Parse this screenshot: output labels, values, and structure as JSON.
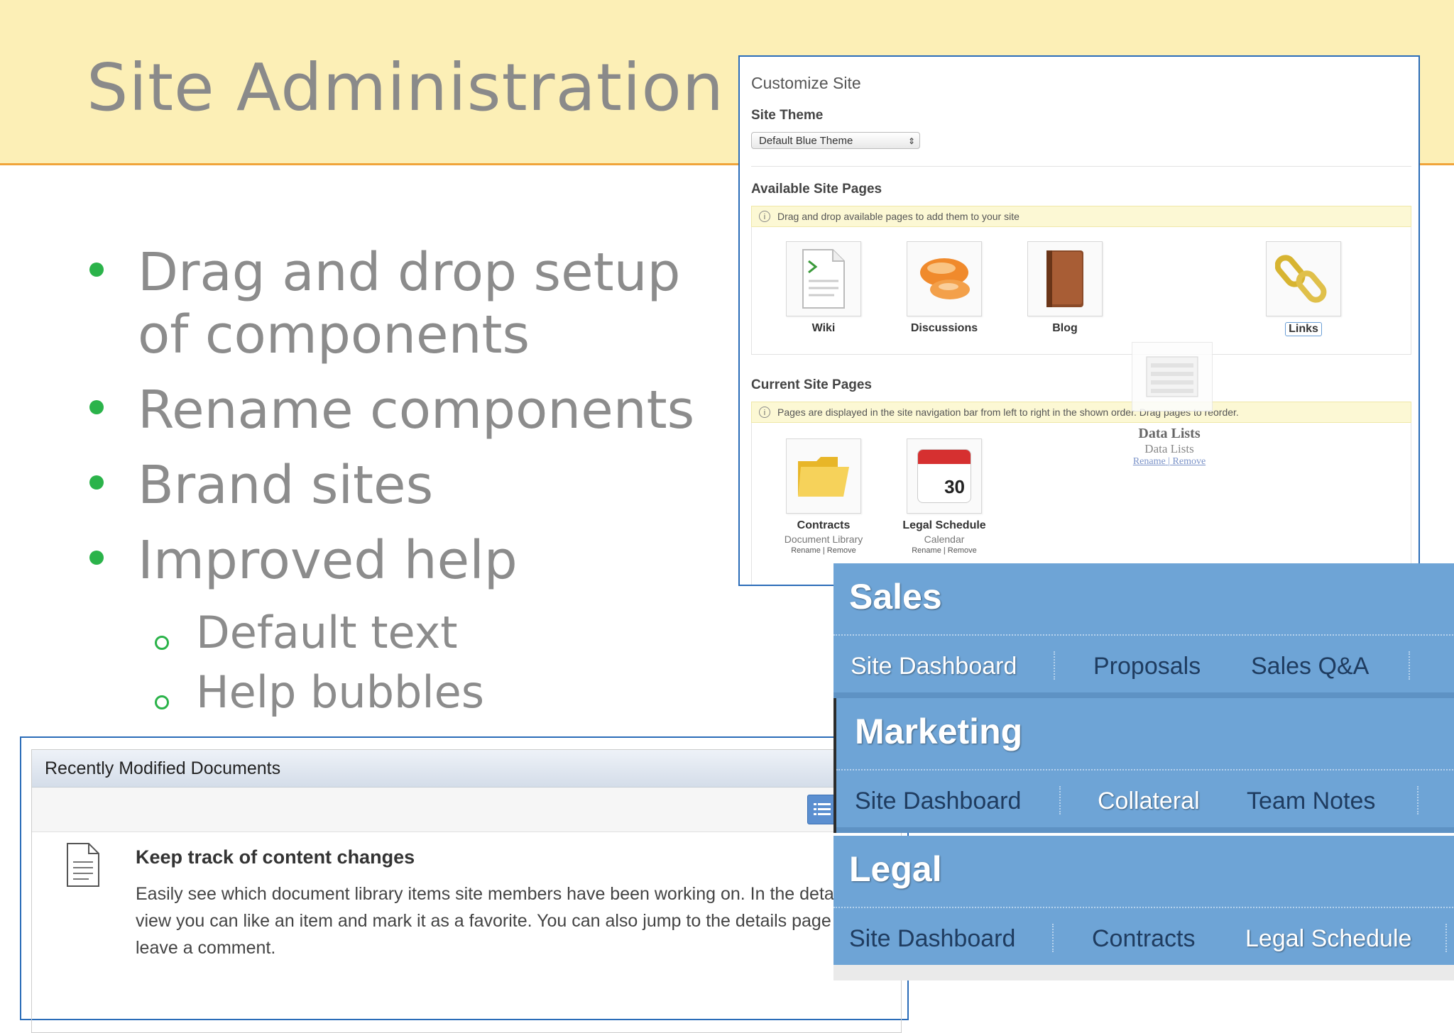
{
  "slide": {
    "title": "Site Administration",
    "bullets": [
      "Drag and drop setup of components",
      "Rename components",
      "Brand sites",
      "Improved help"
    ],
    "sub_bullets": [
      "Default text",
      "Help bubbles"
    ]
  },
  "customize_site": {
    "heading": "Customize Site",
    "theme_label": "Site Theme",
    "theme_value": "Default Blue Theme",
    "available_heading": "Available Site Pages",
    "available_info": "Drag and drop available pages to add them to your site",
    "available_pages": [
      {
        "label": "Wiki"
      },
      {
        "label": "Discussions"
      },
      {
        "label": "Blog"
      },
      {
        "label": "Links"
      }
    ],
    "current_heading": "Current Site Pages",
    "current_info": "Pages are displayed in the site navigation bar from left to right in the shown order. Drag pages to reorder.",
    "current_pages": [
      {
        "label": "Contracts",
        "type": "Document Library",
        "actions": "Rename | Remove"
      },
      {
        "label": "Legal Schedule",
        "type": "Calendar",
        "actions": "Rename | Remove"
      }
    ],
    "dragging": {
      "title": "Data Lists",
      "type": "Data Lists",
      "rename": "Rename",
      "sep": "|",
      "remove": "Remove"
    },
    "calendar_day": "30"
  },
  "recent_docs": {
    "title": "Recently Modified Documents",
    "tip_title": "Keep track of content changes",
    "tip_body": "Easily see which document library items site members have been working on. In the detailed view you can like an item and mark it as a favorite. You can also jump to the details page to leave a comment."
  },
  "sites": [
    {
      "name": "Sales",
      "nav": [
        "Site Dashboard",
        "Proposals",
        "Sales Q&A"
      ]
    },
    {
      "name": "Marketing",
      "nav": [
        "Site Dashboard",
        "Collateral",
        "Team Notes"
      ]
    },
    {
      "name": "Legal",
      "nav": [
        "Site Dashboard",
        "Contracts",
        "Legal Schedule"
      ]
    }
  ],
  "colors": {
    "accent_green": "#2bb34a",
    "header_band": "#fcefb6",
    "nav_blue": "#6ea4d6"
  }
}
